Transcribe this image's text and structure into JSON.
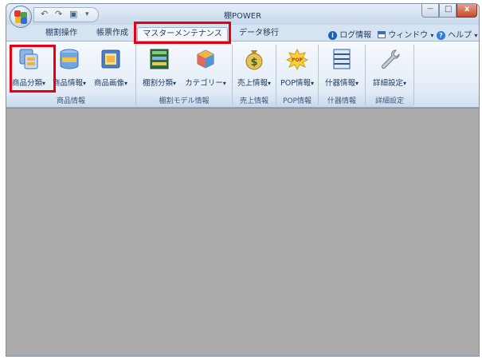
{
  "window": {
    "title": "棚POWER",
    "qat": {
      "undo_glyph": "↶",
      "redo_glyph": "↷",
      "save_glyph": "▣",
      "more_glyph": "▾"
    },
    "controls": {
      "minimize": "—",
      "maximize": "□",
      "close": "x"
    }
  },
  "tabs": [
    {
      "label": "棚割操作"
    },
    {
      "label": "帳票作成"
    },
    {
      "label": "マスターメンテナンス",
      "active": true
    },
    {
      "label": "データ移行"
    }
  ],
  "right_menu": {
    "log_icon": "i",
    "log_label": "ログ情報",
    "window_label": "ウィンドウ",
    "window_arrow": "▾",
    "help_icon": "?",
    "help_label": "ヘルプ",
    "help_arrow": "▾"
  },
  "groups": [
    {
      "label": "商品情報",
      "buttons": [
        {
          "label": "商品分類",
          "arrow": "▾",
          "icon": "category-icon"
        },
        {
          "label": "商品情報",
          "arrow": "▾",
          "icon": "database-icon"
        },
        {
          "label": "商品画像",
          "arrow": "▾",
          "icon": "image-icon"
        }
      ]
    },
    {
      "label": "棚割モデル情報",
      "buttons": [
        {
          "label": "棚割分類",
          "arrow": "▾",
          "icon": "shelf-icon"
        },
        {
          "label": "カテゴリー",
          "arrow": "▾",
          "icon": "cube-icon"
        }
      ]
    },
    {
      "label": "売上情報",
      "buttons": [
        {
          "label": "売上情報",
          "arrow": "▾",
          "icon": "money-bag-icon",
          "glyph": "$"
        }
      ]
    },
    {
      "label": "POP情報",
      "buttons": [
        {
          "label": "POP情報",
          "arrow": "▾",
          "icon": "pop-icon",
          "glyph": "POP"
        }
      ]
    },
    {
      "label": "什器情報",
      "buttons": [
        {
          "label": "什器情報",
          "arrow": "▾",
          "icon": "fixture-icon"
        }
      ]
    },
    {
      "label": "詳細設定",
      "buttons": [
        {
          "label": "詳細設定",
          "arrow": "▾",
          "icon": "wrench-icon"
        }
      ]
    }
  ],
  "colors": {
    "highlight": "#e60012",
    "workspace": "#ababab",
    "ribbon": "#e4edf7"
  }
}
